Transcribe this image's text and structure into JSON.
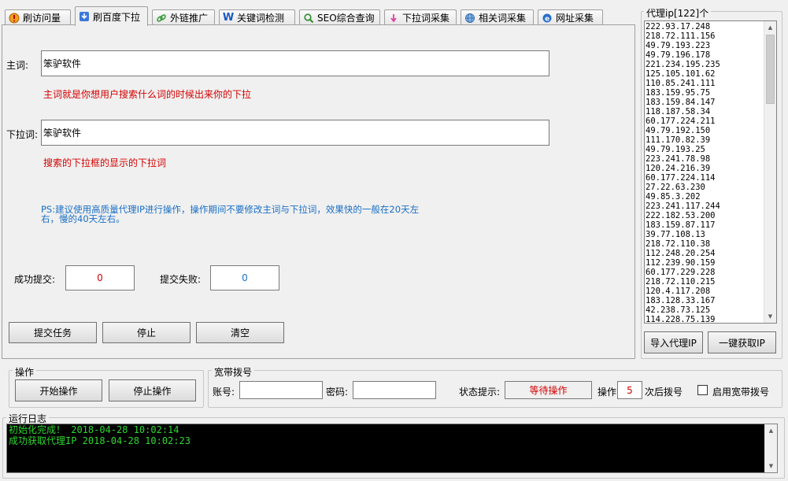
{
  "tabs": [
    {
      "label": "刷访问量",
      "icon": "shield-icon",
      "active": false
    },
    {
      "label": "刷百度下拉",
      "icon": "download-icon",
      "active": true
    },
    {
      "label": "外链推广",
      "icon": "link-icon",
      "active": false
    },
    {
      "label": "关键词检测",
      "icon": "w-icon",
      "active": false
    },
    {
      "label": "SEO综合查询",
      "icon": "search-icon",
      "active": false
    },
    {
      "label": "下拉词采集",
      "icon": "down-arrow-icon",
      "active": false
    },
    {
      "label": "相关词采集",
      "icon": "globe-icon",
      "active": false
    },
    {
      "label": "网址采集",
      "icon": "ie-icon",
      "active": false
    }
  ],
  "form": {
    "main_word_label": "主词:",
    "main_word_value": "笨驴软件",
    "main_word_hint": "主词就是你想用户搜索什么词的时候出来你的下拉",
    "dropdown_word_label": "下拉词:",
    "dropdown_word_value": "笨驴软件",
    "dropdown_word_hint": "搜索的下拉框的显示的下拉词",
    "ps_line1": "PS:建议使用高质量代理IP进行操作，操作期间不要修改主词与下拉词，效果快的一般在20天左",
    "ps_line2": "右，慢的40天左右。",
    "success_label": "成功提交:",
    "success_value": "0",
    "fail_label": "提交失败:",
    "fail_value": "0"
  },
  "task_buttons": {
    "submit": "提交任务",
    "stop": "停止",
    "clear": "清空"
  },
  "proxy": {
    "title": "代理ip[122]个",
    "items": [
      "222.93.17.248",
      "218.72.111.156",
      "49.79.193.223",
      "49.79.196.178",
      "221.234.195.235",
      "125.105.101.62",
      "110.85.241.111",
      "183.159.95.75",
      "183.159.84.147",
      "118.187.58.34",
      "60.177.224.211",
      "49.79.192.150",
      "111.170.82.39",
      "49.79.193.25",
      "223.241.78.98",
      "120.24.216.39",
      "60.177.224.114",
      "27.22.63.230",
      "49.85.3.202",
      "223.241.117.244",
      "222.182.53.200",
      "183.159.87.117",
      "39.77.108.13",
      "218.72.110.38",
      "112.248.20.254",
      "112.239.90.159",
      "60.177.229.228",
      "218.72.110.215",
      "120.4.117.208",
      "183.128.33.167",
      "42.238.73.125",
      "114.228.75.139"
    ],
    "import_button": "导入代理IP",
    "fetch_button": "一键获取IP"
  },
  "operation": {
    "title": "操作",
    "start_button": "开始操作",
    "stop_button": "停止操作"
  },
  "broadband": {
    "title": "宽带拨号",
    "account_label": "账号:",
    "account_value": "",
    "password_label": "密码:",
    "password_value": "",
    "status_label": "状态提示:",
    "status_value": "等待操作",
    "op_label": "操作",
    "op_count": "5",
    "after_label": "次后拨号",
    "enable_label": "启用宽带拨号"
  },
  "log": {
    "title": "运行日志",
    "lines": [
      "初始化完成！ 2018-04-28 10:02:14",
      "成功获取代理IP 2018-04-28 10:02:23"
    ]
  },
  "colors": {
    "hint_red": "#d40000",
    "ps_blue": "#1a6fc6",
    "log_green": "#2fd82f"
  }
}
